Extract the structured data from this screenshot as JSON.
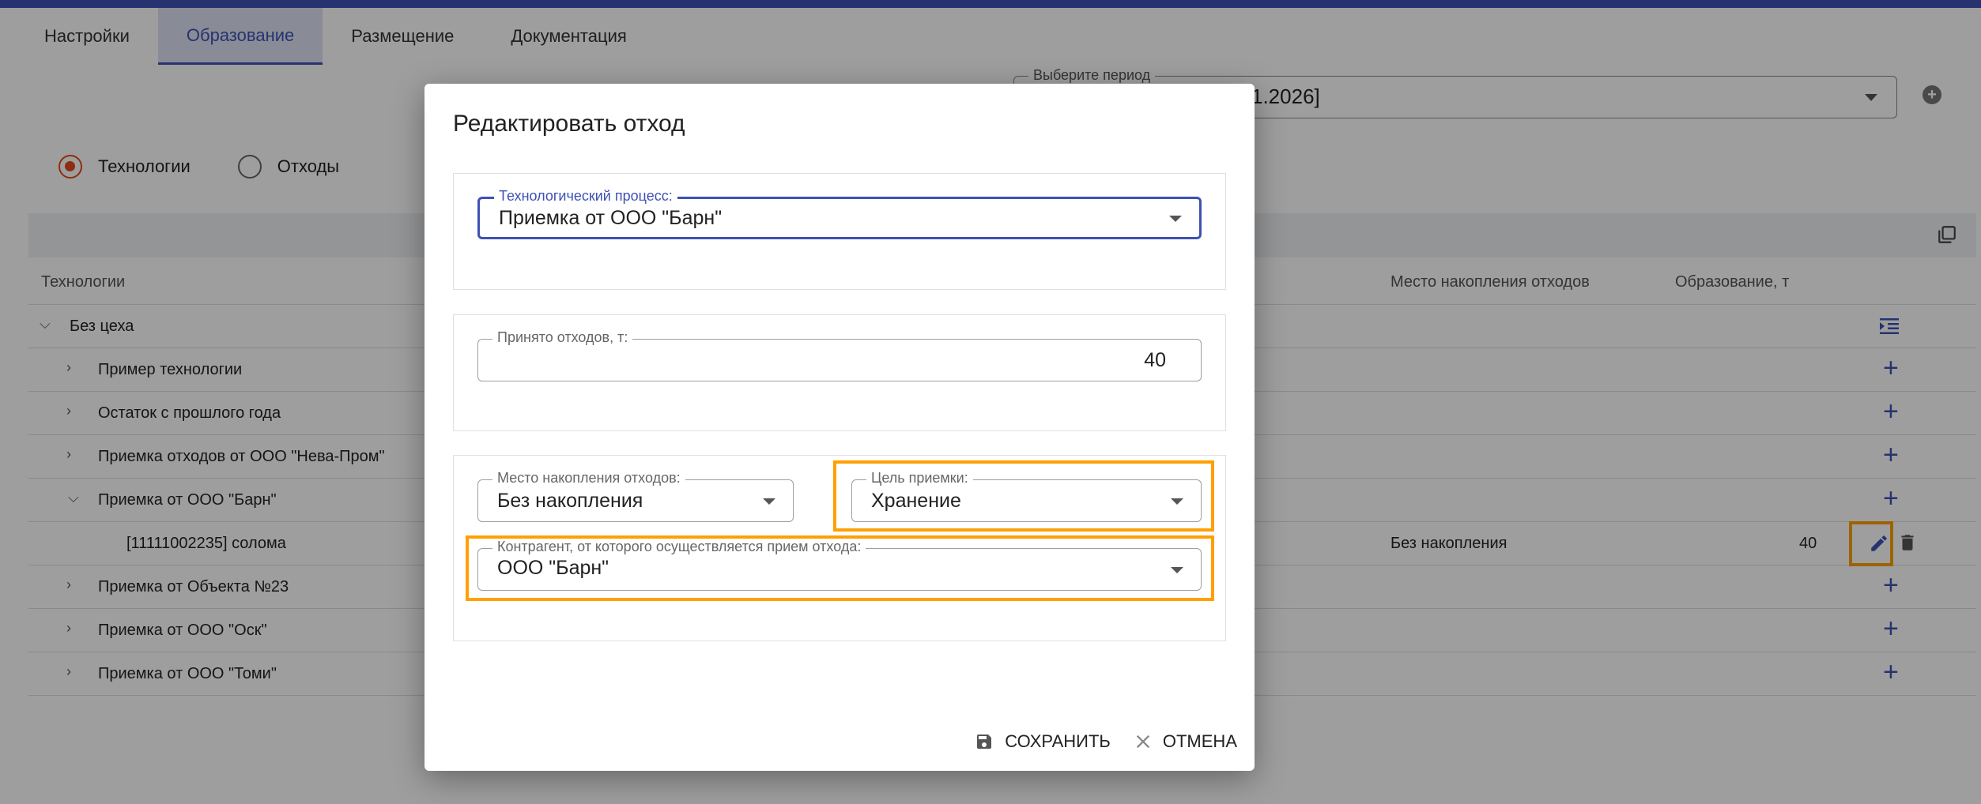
{
  "tabs": [
    {
      "label": "Настройки"
    },
    {
      "label": "Образование"
    },
    {
      "label": "Размещение"
    },
    {
      "label": "Документация"
    }
  ],
  "period": {
    "label": "Выберите период",
    "value": "1.2026]"
  },
  "radio": {
    "technologies": "Технологии",
    "wastes": "Отходы"
  },
  "table": {
    "headers": {
      "technologies": "Технологии",
      "accumulation_place": "Место накопления отходов",
      "formation": "Образование, т"
    },
    "rows": [
      {
        "label": "Без цеха"
      },
      {
        "label": "Пример технологии"
      },
      {
        "label": "Остаток с прошлого года"
      },
      {
        "label": "Приемка отходов от ООО \"Нева-Пром\""
      },
      {
        "label": "Приемка от ООО \"Барн\""
      },
      {
        "label": "[11111002235] солома",
        "place": "Без накопления",
        "amount": "40"
      },
      {
        "label": "Приемка от Объекта №23"
      },
      {
        "label": "Приемка от ООО \"Оск\""
      },
      {
        "label": "Приемка от ООО \"Томи\""
      }
    ]
  },
  "dialog": {
    "title": "Редактировать отход",
    "process": {
      "label": "Технологический процесс:",
      "value": "Приемка от ООО \"Барн\""
    },
    "accepted": {
      "label": "Принято отходов, т:",
      "value": "40"
    },
    "place": {
      "label": "Место накопления отходов:",
      "value": "Без накопления"
    },
    "goal": {
      "label": "Цель приемки:",
      "value": "Хранение"
    },
    "counterparty": {
      "label": "Контрагент, от которого осуществляется прием отхода:",
      "value": "ООО \"Барн\""
    },
    "save": "СОХРАНИТЬ",
    "cancel": "ОТМЕНА"
  },
  "colors": {
    "accent": "#3f51b5",
    "radio": "#e64a19",
    "highlight": "#ffa000"
  }
}
